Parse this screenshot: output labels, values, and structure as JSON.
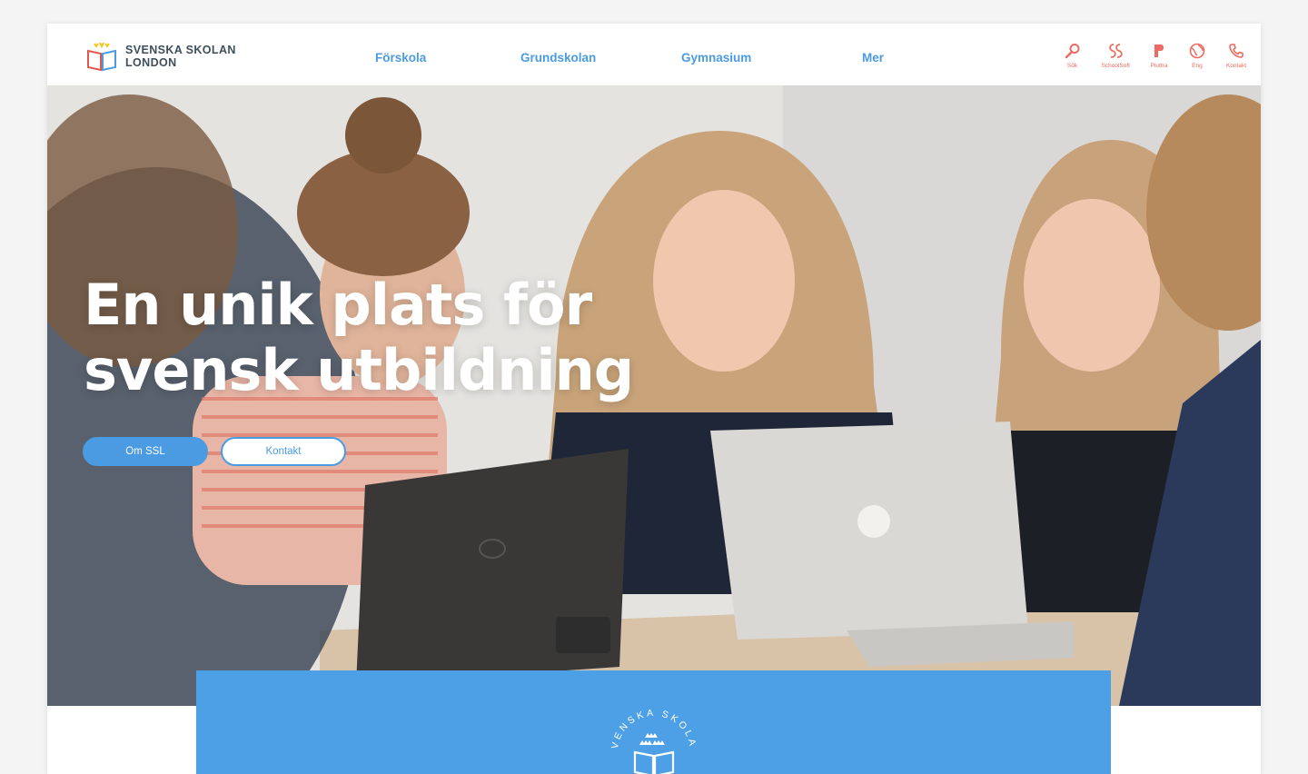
{
  "header": {
    "logo": {
      "line1": "SVENSKA SKOLAN",
      "line2": "LONDON",
      "icon": "open-book-icon"
    },
    "nav": [
      {
        "label": "Förskola"
      },
      {
        "label": "Grundskolan"
      },
      {
        "label": "Gymnasium"
      },
      {
        "label": "Mer"
      }
    ],
    "tools": [
      {
        "label": "Sök",
        "icon": "search-icon"
      },
      {
        "label": "SchoolSoft",
        "icon": "schoolsoft-icon"
      },
      {
        "label": "Pluttra",
        "icon": "pluttra-icon"
      },
      {
        "label": "Eng",
        "icon": "globe-icon"
      },
      {
        "label": "Kontakt",
        "icon": "phone-icon"
      }
    ]
  },
  "hero": {
    "title_line1": "En unik plats för",
    "title_line2": "svensk utbildning",
    "buttons": {
      "primary": "Om SSL",
      "secondary": "Kontakt"
    }
  },
  "band": {
    "seal_text": "SVENSKA SKOLAN"
  },
  "colors": {
    "accent_blue": "#4a9be2",
    "band_blue": "#4ea0e6",
    "icon_red": "#ec6a60",
    "logo_text": "#3d4f5c"
  }
}
